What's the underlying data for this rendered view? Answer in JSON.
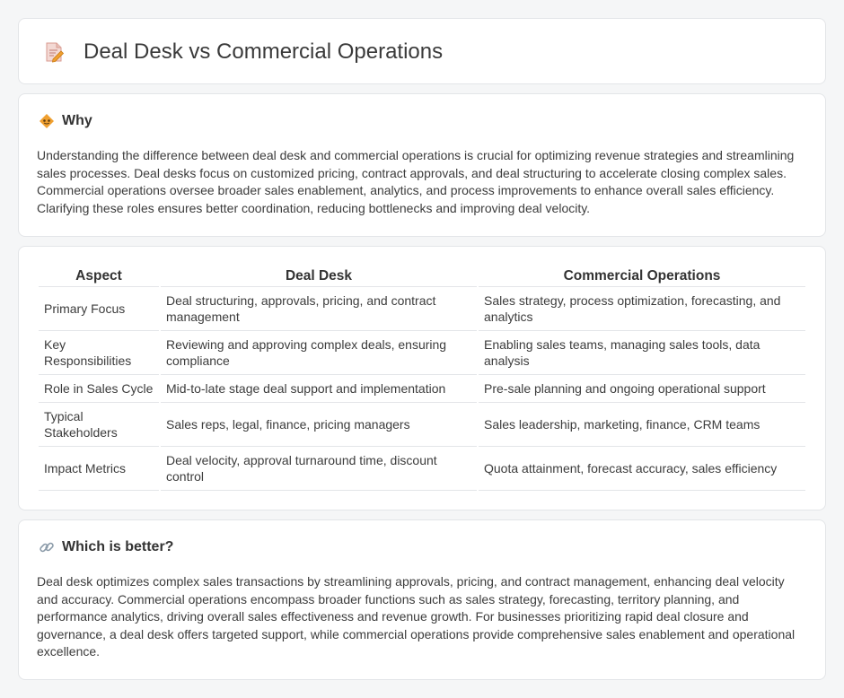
{
  "page": {
    "title": "Deal Desk vs Commercial Operations",
    "title_icon": "document-edit-icon"
  },
  "why": {
    "icon": "warning-diamond-icon",
    "heading": "Why",
    "text": "Understanding the difference between deal desk and commercial operations is crucial for optimizing revenue strategies and streamlining sales processes. Deal desks focus on customized pricing, contract approvals, and deal structuring to accelerate closing complex sales. Commercial operations oversee broader sales enablement, analytics, and process improvements to enhance overall sales efficiency. Clarifying these roles ensures better coordination, reducing bottlenecks and improving deal velocity."
  },
  "table": {
    "headers": [
      "Aspect",
      "Deal Desk",
      "Commercial Operations"
    ],
    "rows": [
      [
        "Primary Focus",
        "Deal structuring, approvals, pricing, and contract management",
        "Sales strategy, process optimization, forecasting, and analytics"
      ],
      [
        "Key Responsibilities",
        "Reviewing and approving complex deals, ensuring compliance",
        "Enabling sales teams, managing sales tools, data analysis"
      ],
      [
        "Role in Sales Cycle",
        "Mid-to-late stage deal support and implementation",
        "Pre-sale planning and ongoing operational support"
      ],
      [
        "Typical Stakeholders",
        "Sales reps, legal, finance, pricing managers",
        "Sales leadership, marketing, finance, CRM teams"
      ],
      [
        "Impact Metrics",
        "Deal velocity, approval turnaround time, discount control",
        "Quota attainment, forecast accuracy, sales efficiency"
      ]
    ]
  },
  "better": {
    "icon": "link-icon",
    "heading": "Which is better?",
    "text": "Deal desk optimizes complex sales transactions by streamlining approvals, pricing, and contract management, enhancing deal velocity and accuracy. Commercial operations encompass broader functions such as sales strategy, forecasting, territory planning, and performance analytics, driving overall sales effectiveness and revenue growth. For businesses prioritizing rapid deal closure and governance, a deal desk offers targeted support, while commercial operations provide comprehensive sales enablement and operational excellence."
  },
  "colors": {
    "background": "#f5f6f7",
    "card": "#ffffff",
    "border": "#e3e5e8",
    "icon_accent": "#f0a030"
  }
}
